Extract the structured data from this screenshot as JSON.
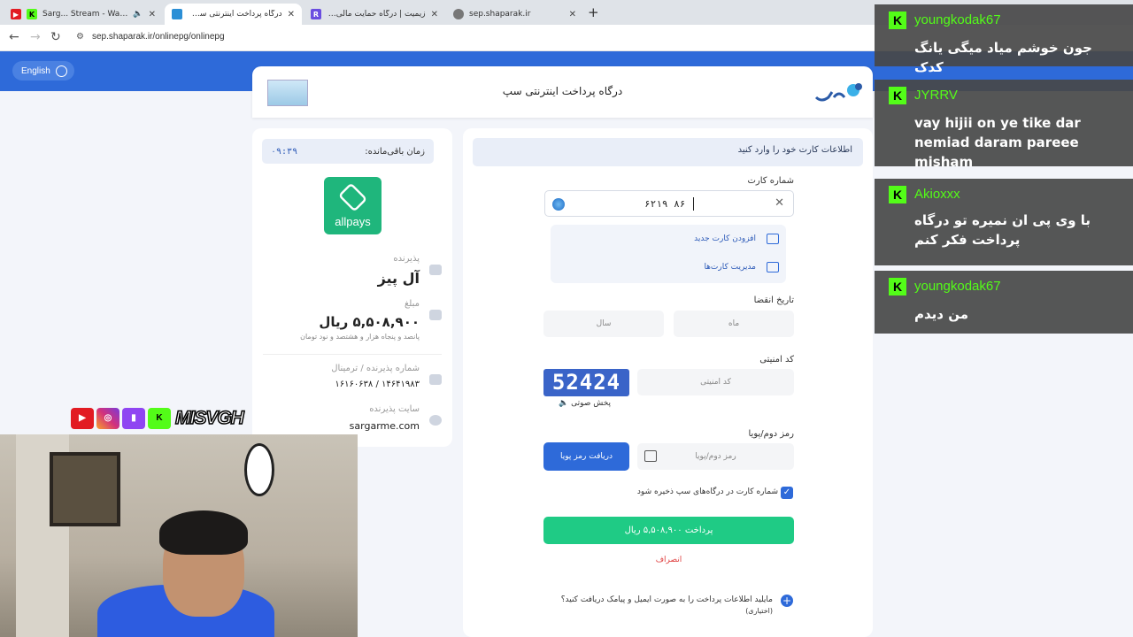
{
  "browser": {
    "tabs": [
      {
        "title": "Sarg... Stream - Watch",
        "favicon_color": "#e21b22",
        "active": false
      },
      {
        "title": "درگاه پرداخت اینترنتی سپ - پرداخ",
        "favicon_color": "#2b8fd6",
        "active": true
      },
      {
        "title": "زیمیت | درگاه حمایت مالی از Zed",
        "favicon_color": "#6a4de0",
        "active": false
      },
      {
        "title": "sep.shaparak.ir",
        "favicon_color": "#777777",
        "active": false
      }
    ],
    "url": "sep.shaparak.ir/onlinepg/onlinepg",
    "new_tab": "+"
  },
  "page": {
    "language_button": "English",
    "gateway_title": "درگاه پرداخت اینترنتی سپ",
    "timer_label": "زمان باقی‌مانده:",
    "timer_value": "۰۹:۳۹",
    "merchant_logo_text": "allpays",
    "acceptor_label": "پذیرنده",
    "acceptor_value": "آل پیز",
    "amount_label": "مبلغ",
    "amount_value": "۵,۵۰۸,۹۰۰ ریال",
    "amount_words": "پانصد و پنجاه هزار و هشتصد و نود تومان",
    "terminal_label": "شماره پذیرنده / ترمینال",
    "terminal_value": "۱۴۶۴۱۹۸۳ / ۱۶۱۶۰۶۳۸",
    "site_label": "سایت پذیرنده",
    "site_value": "sargarme.com"
  },
  "form": {
    "header": "اطلاعات کارت خود را وارد کنید",
    "card_number_label": "شماره کارت",
    "card_number_value": "۶۲۱۹ ۸۶",
    "dropdown_items": [
      "افزودن کارت جدید",
      "مدیریت کارت‌ها"
    ],
    "expiry_label": "تاریخ انقضا",
    "month_placeholder": "ماه",
    "year_placeholder": "سال",
    "cvv_label": "کد امنیتی",
    "captcha_text": "52424",
    "captcha_placeholder": "کد امنیتی",
    "audio_label": "پخش صوتی",
    "otp_label": "رمز دوم/پویا",
    "otp_placeholder": "رمز دوم/پویا",
    "otp_button": "دریافت رمز پویا",
    "save_card_label": "شماره کارت در درگاه‌های سپ ذخیره شود",
    "pay_button": "پرداخت ۵,۵۰۸,۹۰۰ ریال",
    "cancel_button": "انصراف",
    "email_question": "مایلید اطلاعات پرداخت را به صورت ایمیل و پیامک دریافت کنید؟",
    "email_optional": "(اختیاری)"
  },
  "chat": [
    {
      "user": "youngkodak67",
      "message": "جون خوشم میاد میگی یانگ کدک",
      "rtl": true
    },
    {
      "user": "JYRRV",
      "message": "vay hijii on ye tike dar nemiad daram pareee misham",
      "rtl": false
    },
    {
      "user": "Akioxxx",
      "message": "با وی پی ان نمیره تو درگاه پرداخت فکر کنم",
      "rtl": true
    },
    {
      "user": "youngkodak67",
      "message": "من دیدم",
      "rtl": true
    }
  ],
  "overlay": {
    "streamer_name": "MISVGH",
    "social_icons": [
      "youtube-icon",
      "instagram-icon",
      "twitch-icon",
      "kick-icon"
    ],
    "kick_badge": "K"
  },
  "colors": {
    "brand_blue": "#2e6ad9",
    "pay_green": "#1fcb85",
    "kick_green": "#53fc18",
    "cancel_red": "#e04040"
  }
}
